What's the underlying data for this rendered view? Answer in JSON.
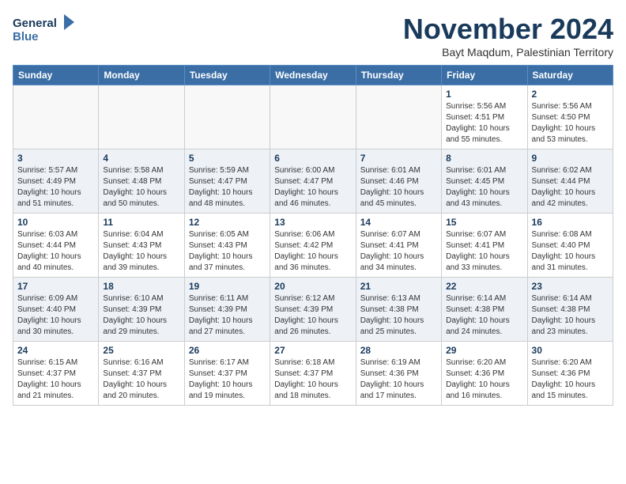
{
  "logo": {
    "line1": "General",
    "line2": "Blue"
  },
  "title": "November 2024",
  "subtitle": "Bayt Maqdum, Palestinian Territory",
  "days_of_week": [
    "Sunday",
    "Monday",
    "Tuesday",
    "Wednesday",
    "Thursday",
    "Friday",
    "Saturday"
  ],
  "weeks": [
    [
      {
        "day": "",
        "info": ""
      },
      {
        "day": "",
        "info": ""
      },
      {
        "day": "",
        "info": ""
      },
      {
        "day": "",
        "info": ""
      },
      {
        "day": "",
        "info": ""
      },
      {
        "day": "1",
        "info": "Sunrise: 5:56 AM\nSunset: 4:51 PM\nDaylight: 10 hours\nand 55 minutes."
      },
      {
        "day": "2",
        "info": "Sunrise: 5:56 AM\nSunset: 4:50 PM\nDaylight: 10 hours\nand 53 minutes."
      }
    ],
    [
      {
        "day": "3",
        "info": "Sunrise: 5:57 AM\nSunset: 4:49 PM\nDaylight: 10 hours\nand 51 minutes."
      },
      {
        "day": "4",
        "info": "Sunrise: 5:58 AM\nSunset: 4:48 PM\nDaylight: 10 hours\nand 50 minutes."
      },
      {
        "day": "5",
        "info": "Sunrise: 5:59 AM\nSunset: 4:47 PM\nDaylight: 10 hours\nand 48 minutes."
      },
      {
        "day": "6",
        "info": "Sunrise: 6:00 AM\nSunset: 4:47 PM\nDaylight: 10 hours\nand 46 minutes."
      },
      {
        "day": "7",
        "info": "Sunrise: 6:01 AM\nSunset: 4:46 PM\nDaylight: 10 hours\nand 45 minutes."
      },
      {
        "day": "8",
        "info": "Sunrise: 6:01 AM\nSunset: 4:45 PM\nDaylight: 10 hours\nand 43 minutes."
      },
      {
        "day": "9",
        "info": "Sunrise: 6:02 AM\nSunset: 4:44 PM\nDaylight: 10 hours\nand 42 minutes."
      }
    ],
    [
      {
        "day": "10",
        "info": "Sunrise: 6:03 AM\nSunset: 4:44 PM\nDaylight: 10 hours\nand 40 minutes."
      },
      {
        "day": "11",
        "info": "Sunrise: 6:04 AM\nSunset: 4:43 PM\nDaylight: 10 hours\nand 39 minutes."
      },
      {
        "day": "12",
        "info": "Sunrise: 6:05 AM\nSunset: 4:43 PM\nDaylight: 10 hours\nand 37 minutes."
      },
      {
        "day": "13",
        "info": "Sunrise: 6:06 AM\nSunset: 4:42 PM\nDaylight: 10 hours\nand 36 minutes."
      },
      {
        "day": "14",
        "info": "Sunrise: 6:07 AM\nSunset: 4:41 PM\nDaylight: 10 hours\nand 34 minutes."
      },
      {
        "day": "15",
        "info": "Sunrise: 6:07 AM\nSunset: 4:41 PM\nDaylight: 10 hours\nand 33 minutes."
      },
      {
        "day": "16",
        "info": "Sunrise: 6:08 AM\nSunset: 4:40 PM\nDaylight: 10 hours\nand 31 minutes."
      }
    ],
    [
      {
        "day": "17",
        "info": "Sunrise: 6:09 AM\nSunset: 4:40 PM\nDaylight: 10 hours\nand 30 minutes."
      },
      {
        "day": "18",
        "info": "Sunrise: 6:10 AM\nSunset: 4:39 PM\nDaylight: 10 hours\nand 29 minutes."
      },
      {
        "day": "19",
        "info": "Sunrise: 6:11 AM\nSunset: 4:39 PM\nDaylight: 10 hours\nand 27 minutes."
      },
      {
        "day": "20",
        "info": "Sunrise: 6:12 AM\nSunset: 4:39 PM\nDaylight: 10 hours\nand 26 minutes."
      },
      {
        "day": "21",
        "info": "Sunrise: 6:13 AM\nSunset: 4:38 PM\nDaylight: 10 hours\nand 25 minutes."
      },
      {
        "day": "22",
        "info": "Sunrise: 6:14 AM\nSunset: 4:38 PM\nDaylight: 10 hours\nand 24 minutes."
      },
      {
        "day": "23",
        "info": "Sunrise: 6:14 AM\nSunset: 4:38 PM\nDaylight: 10 hours\nand 23 minutes."
      }
    ],
    [
      {
        "day": "24",
        "info": "Sunrise: 6:15 AM\nSunset: 4:37 PM\nDaylight: 10 hours\nand 21 minutes."
      },
      {
        "day": "25",
        "info": "Sunrise: 6:16 AM\nSunset: 4:37 PM\nDaylight: 10 hours\nand 20 minutes."
      },
      {
        "day": "26",
        "info": "Sunrise: 6:17 AM\nSunset: 4:37 PM\nDaylight: 10 hours\nand 19 minutes."
      },
      {
        "day": "27",
        "info": "Sunrise: 6:18 AM\nSunset: 4:37 PM\nDaylight: 10 hours\nand 18 minutes."
      },
      {
        "day": "28",
        "info": "Sunrise: 6:19 AM\nSunset: 4:36 PM\nDaylight: 10 hours\nand 17 minutes."
      },
      {
        "day": "29",
        "info": "Sunrise: 6:20 AM\nSunset: 4:36 PM\nDaylight: 10 hours\nand 16 minutes."
      },
      {
        "day": "30",
        "info": "Sunrise: 6:20 AM\nSunset: 4:36 PM\nDaylight: 10 hours\nand 15 minutes."
      }
    ]
  ]
}
